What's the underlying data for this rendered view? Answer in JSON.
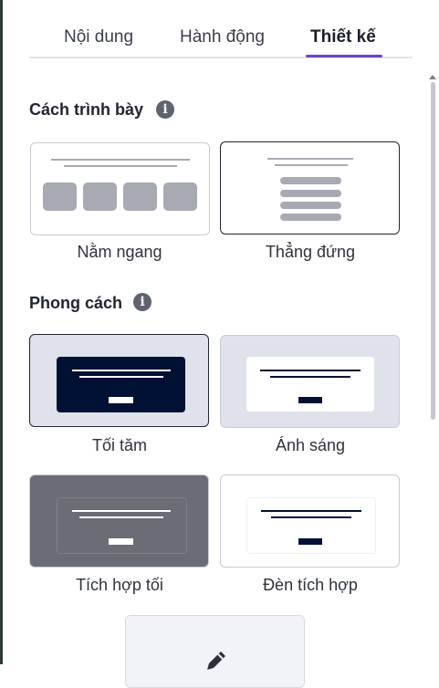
{
  "tabs": [
    {
      "label": "Nội dung",
      "active": false
    },
    {
      "label": "Hành động",
      "active": false
    },
    {
      "label": "Thiết kế",
      "active": true
    }
  ],
  "accent_color": "#6a42d2",
  "layout_section": {
    "title": "Cách trình bày",
    "info_icon": "info-icon",
    "options": [
      {
        "label": "Nằm ngang",
        "selected": false
      },
      {
        "label": "Thẳng đứng",
        "selected": true
      }
    ]
  },
  "style_section": {
    "title": "Phong cách",
    "info_icon": "info-icon",
    "options": [
      {
        "label": "Tối tăm",
        "selected": true,
        "color": "#001133"
      },
      {
        "label": "Ánh sáng",
        "selected": false,
        "color": "#dfe2ea"
      },
      {
        "label": "Tích hợp tối",
        "selected": false,
        "color": "#6a6d75"
      },
      {
        "label": "Đèn tích hợp",
        "selected": false,
        "color": "#ffffff"
      }
    ],
    "custom_option_icon": "pencil-icon"
  }
}
